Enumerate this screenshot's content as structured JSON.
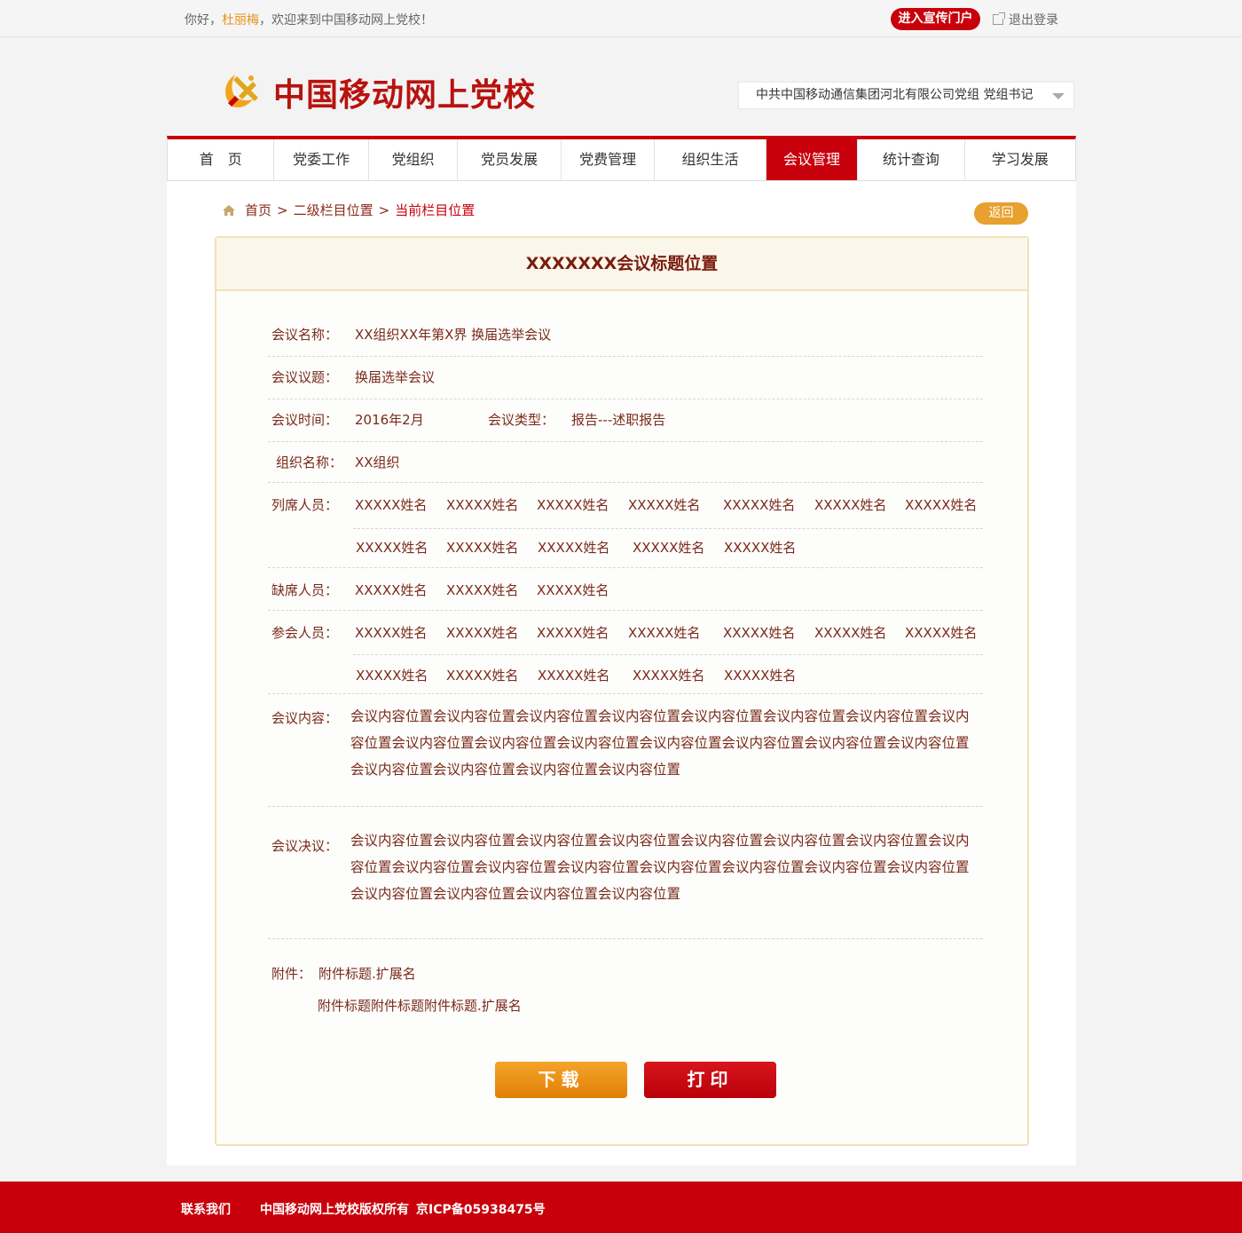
{
  "topbar": {
    "greet_prefix": "你好，",
    "user_name": "杜丽梅",
    "greet_suffix": "，欢迎来到中国移动网上党校！",
    "portal_label": "进入宣传门户",
    "logout_label": "退出登录"
  },
  "header": {
    "site_title": "中国移动网上党校",
    "org_selected": "中共中国移动通信集团河北有限公司党组  党组书记"
  },
  "nav": {
    "items": [
      "首　页",
      "党委工作",
      "党组织",
      "党员发展",
      "党费管理",
      "组织生活",
      "会议管理",
      "统计查询",
      "学习发展"
    ],
    "active_index": 6
  },
  "breadcrumb": {
    "home": "首页",
    "sep": ">",
    "level2": "二级栏目位置",
    "current": "当前栏目位置"
  },
  "back_label": "返回",
  "meeting": {
    "title": "XXXXXXX会议标题位置",
    "name_label": "会议名称：",
    "name_value": "XX组织XX年第X界 换届选举会议",
    "topic_label": "会议议题：",
    "topic_value": "换届选举会议",
    "time_label": "会议时间：",
    "time_value": "2016年2月",
    "type_label": "会议类型：",
    "type_value": "报告---述职报告",
    "org_label": "组织名称：",
    "org_value": "XX组织",
    "attendees_label": "列席人员：",
    "attendees_row1": [
      "XXXXX姓名",
      "XXXXX姓名",
      "XXXXX姓名",
      "XXXXX姓名",
      "XXXXX姓名",
      "XXXXX姓名",
      "XXXXX姓名"
    ],
    "attendees_row2": [
      "XXXXX姓名",
      "XXXXX姓名",
      "XXXXX姓名",
      "XXXXX姓名",
      "XXXXX姓名"
    ],
    "absent_label": "缺席人员：",
    "absent": [
      "XXXXX姓名",
      "XXXXX姓名",
      "XXXXX姓名"
    ],
    "participants_label": "参会人员：",
    "participants_row1": [
      "XXXXX姓名",
      "XXXXX姓名",
      "XXXXX姓名",
      "XXXXX姓名",
      "XXXXX姓名",
      "XXXXX姓名",
      "XXXXX姓名"
    ],
    "participants_row2": [
      "XXXXX姓名",
      "XXXXX姓名",
      "XXXXX姓名",
      "XXXXX姓名",
      "XXXXX姓名"
    ],
    "content_label": "会议内容：",
    "content_text": "会议内容位置会议内容位置会议内容位置会议内容位置会议内容位置会议内容位置会议内容位置会议内容位置会议内容位置会议内容位置会议内容位置会议内容位置会议内容位置会议内容位置会议内容位置会议内容位置会议内容位置会议内容位置会议内容位置",
    "resolution_label": "会议决议：",
    "resolution_text": "会议内容位置会议内容位置会议内容位置会议内容位置会议内容位置会议内容位置会议内容位置会议内容位置会议内容位置会议内容位置会议内容位置会议内容位置会议内容位置会议内容位置会议内容位置会议内容位置会议内容位置会议内容位置会议内容位置",
    "attachment_label": "附件：",
    "attachments": [
      "附件标题.扩展名",
      "附件标题附件标题附件标题.扩展名"
    ]
  },
  "actions": {
    "download": "下载",
    "print": "打印"
  },
  "footer": {
    "contact": "联系我们",
    "copyright": "中国移动网上党校版权所有",
    "icp": "京ICP备05938475号"
  },
  "colors": {
    "brand_red": "#c8000b",
    "accent_orange": "#e8a02e",
    "text_brown": "#7a2a1a"
  }
}
